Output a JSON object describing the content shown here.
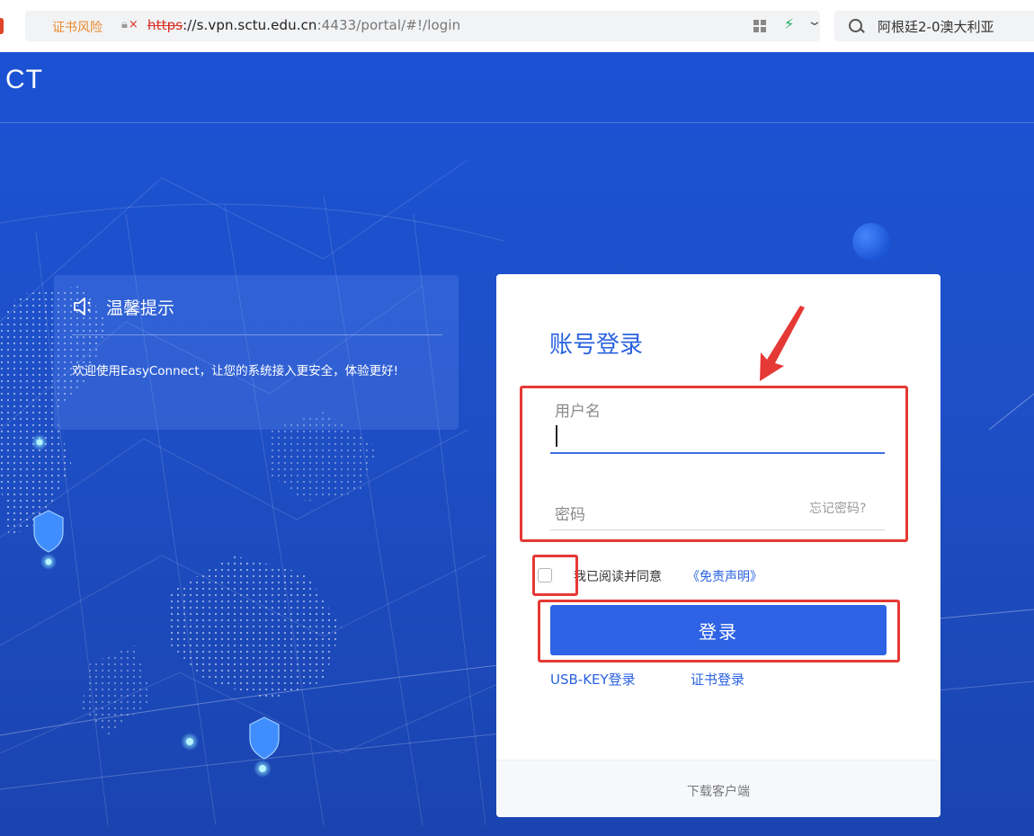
{
  "browser": {
    "cert_warning": "证书风险",
    "url": {
      "scheme": "https",
      "rest_host": "://s.vpn.sctu.edu.cn",
      "rest_path": ":4433/portal/#!/login"
    },
    "search_text": "阿根廷2-0澳大利亚"
  },
  "header": {
    "logo_text": "CT"
  },
  "tip": {
    "title": "温馨提示",
    "body": "欢迎使用EasyConnect，让您的系统接入更安全，体验更好!"
  },
  "login": {
    "title": "账号登录",
    "username_label": "用户名",
    "username_value": "",
    "password_label": "密码",
    "forgot_label": "忘记密码?",
    "agree_label": "我已阅读并同意",
    "disclaimer_label": "《免责声明》",
    "login_button": "登录",
    "usbkey_label": "USB-KEY登录",
    "cert_label": "证书登录",
    "download_label": "下载客户端"
  },
  "colors": {
    "brand_blue": "#2f63e5",
    "background_blue": "#1b52d4",
    "annotation_red": "#e53935",
    "cert_warning_orange": "#e8892c"
  }
}
